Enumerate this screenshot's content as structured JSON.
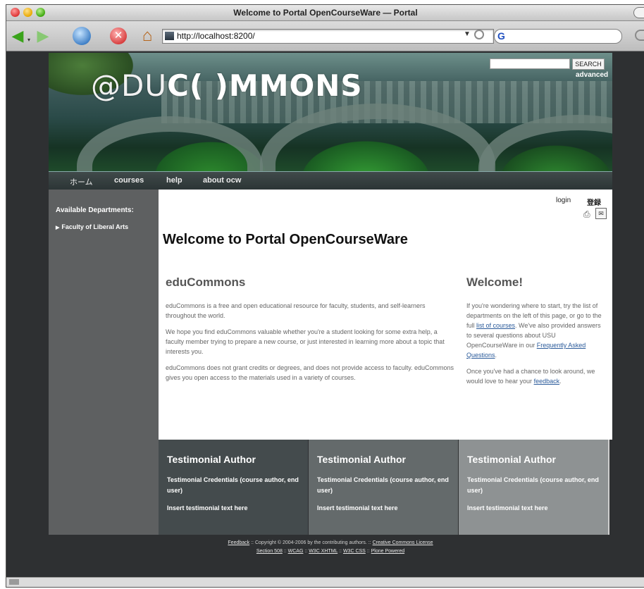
{
  "window": {
    "title": "Welcome to Portal OpenCourseWare — Portal"
  },
  "browser": {
    "url": "http://localhost:8200/",
    "search_icon_letter": "G"
  },
  "site": {
    "logo_part1": "@DU",
    "logo_part2": "C( )MMONS",
    "search_button": "SEARCH",
    "advanced_link": "advanced",
    "nav": [
      "ホーム",
      "courses",
      "help",
      "about ocw"
    ]
  },
  "sidebar": {
    "heading": "Available Departments:",
    "items": [
      "Faculty of Liberal Arts"
    ]
  },
  "header_links": {
    "login": "login",
    "register": "登録"
  },
  "page_title": "Welcome to Portal OpenCourseWare",
  "main": {
    "heading": "eduCommons",
    "paragraphs": [
      "eduCommons is a free and open educational resource for faculty, students, and self-learners throughout the world.",
      "We hope you find eduCommons valuable whether you're a student looking for some extra help, a faculty member trying to prepare a new course, or just interested in learning more about a topic that interests you.",
      "eduCommons does not grant credits or degrees, and does not provide access to faculty. eduCommons gives you open access to the materials used in a variety of courses."
    ]
  },
  "welcome": {
    "heading": "Welcome!",
    "p1_a": "If you're wondering where to start, try the list of departments on the left of this page, or go to the full ",
    "p1_link1": "list of courses",
    "p1_b": ". We've also provided answers to several questions about USU OpenCourseWare in our ",
    "p1_link2": "Frequently Asked Questions",
    "p1_c": ".",
    "p2_a": "Once you've had a chance to look around, we would love to hear your ",
    "p2_link": "feedback",
    "p2_b": "."
  },
  "testimonials": [
    {
      "title": "Testimonial Author",
      "credentials": "Testimonial Credentials (course author, end user)",
      "text": "Insert testimonial text here"
    },
    {
      "title": "Testimonial Author",
      "credentials": "Testimonial Credentials (course author, end user)",
      "text": "Insert testimonial text here"
    },
    {
      "title": "Testimonial Author",
      "credentials": "Testimonial Credentials (course author, end user)",
      "text": "Insert testimonial text here"
    }
  ],
  "footer": {
    "feedback": "Feedback",
    "copyright": "Copyright © 2004-2006 by the contributing authors.",
    "cc": "Creative Commons License",
    "links": [
      "Section 508",
      "WCAG",
      "W3C XHTML",
      "W3C CSS",
      "Plone Powered"
    ]
  }
}
